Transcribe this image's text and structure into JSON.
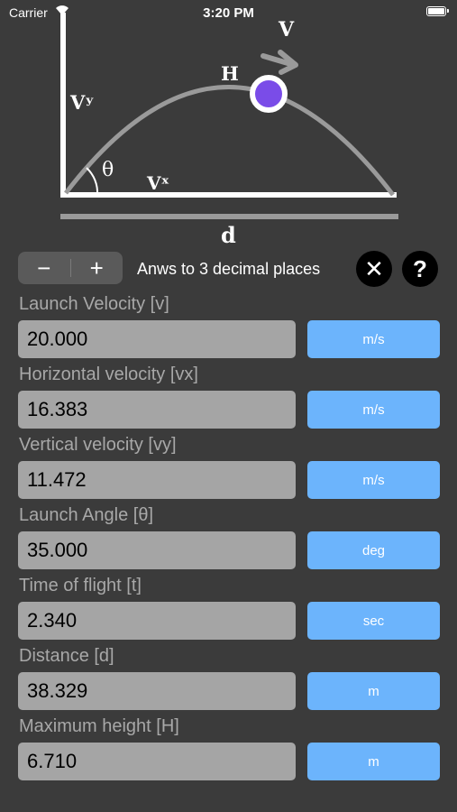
{
  "status_bar": {
    "carrier": "Carrier",
    "time": "3:20 PM"
  },
  "diagram": {
    "label_v": "V",
    "label_vy": "Vʸ",
    "label_h": "H",
    "label_theta": "θ",
    "label_vx": "Vˣ",
    "label_d": "d",
    "colors": {
      "axis": "#ffffff",
      "trajectory": "#9a9a9a",
      "ground": "#9a9a9a",
      "ball": "#7a4ce8"
    }
  },
  "toolbar": {
    "minus_label": "−",
    "plus_label": "+",
    "decimal_label": "Anws to 3 decimal places",
    "clear_icon": "✕",
    "help_icon": "?"
  },
  "fields": [
    {
      "label": "Launch Velocity [v]",
      "value": "20.000",
      "unit": "m/s"
    },
    {
      "label": "Horizontal velocity [vx]",
      "value": "16.383",
      "unit": "m/s"
    },
    {
      "label": "Vertical velocity [vy]",
      "value": "11.472",
      "unit": "m/s"
    },
    {
      "label": "Launch Angle [θ]",
      "value": "35.000",
      "unit": "deg"
    },
    {
      "label": "Time of flight [t]",
      "value": "2.340",
      "unit": "sec"
    },
    {
      "label": "Distance [d]",
      "value": "38.329",
      "unit": "m"
    },
    {
      "label": "Maximum height [H]",
      "value": "6.710",
      "unit": "m"
    }
  ],
  "colors": {
    "background": "#3b3b3b",
    "field_background": "#a5a5a5",
    "unit_button": "#6cb4fc",
    "label_text": "#a8a8a8"
  }
}
